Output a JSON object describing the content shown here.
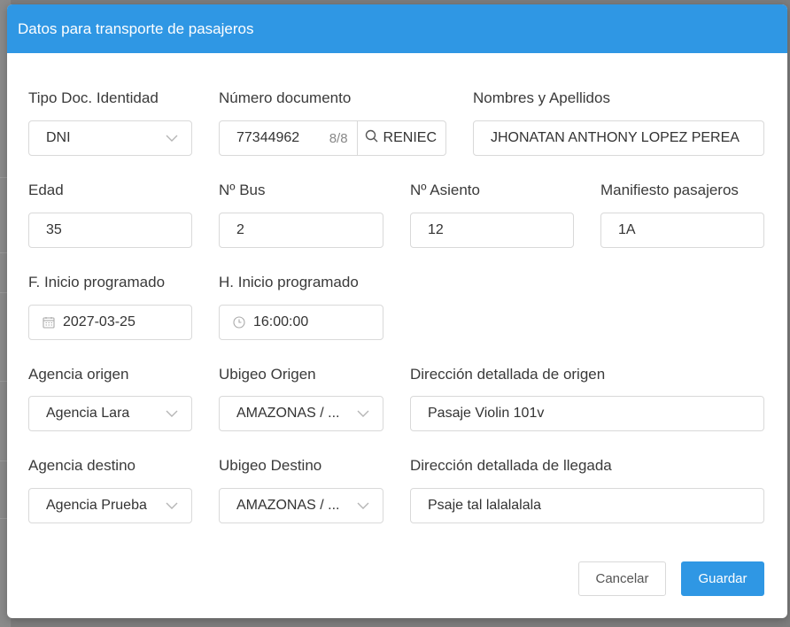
{
  "dialog": {
    "title": "Datos para transporte de pasajeros"
  },
  "fields": {
    "tipo_doc": {
      "label": "Tipo Doc. Identidad",
      "value": "DNI"
    },
    "numero_doc": {
      "label": "Número documento",
      "value": "77344962",
      "counter": "8/8",
      "lookup_label": "RENIEC"
    },
    "nombres": {
      "label": "Nombres y Apellidos",
      "value": "JHONATAN ANTHONY LOPEZ PEREA"
    },
    "edad": {
      "label": "Edad",
      "value": "35"
    },
    "bus": {
      "label": "Nº Bus",
      "value": "2"
    },
    "asiento": {
      "label": "Nº Asiento",
      "value": "12"
    },
    "manifiesto": {
      "label": "Manifiesto pasajeros",
      "value": "1A"
    },
    "fecha_inicio": {
      "label": "F. Inicio programado",
      "value": "2027-03-25"
    },
    "hora_inicio": {
      "label": "H. Inicio programado",
      "value": "16:00:00"
    },
    "agencia_origen": {
      "label": "Agencia origen",
      "value": "Agencia Lara"
    },
    "ubigeo_origen": {
      "label": "Ubigeo Origen",
      "value": "AMAZONAS / ..."
    },
    "direccion_origen": {
      "label": "Dirección detallada de origen",
      "value": "Pasaje Violin 101v"
    },
    "agencia_destino": {
      "label": "Agencia destino",
      "value": "Agencia Prueba"
    },
    "ubigeo_destino": {
      "label": "Ubigeo Destino",
      "value": "AMAZONAS / ..."
    },
    "direccion_llegada": {
      "label": "Dirección detallada de llegada",
      "value": "Psaje tal lalalalala"
    }
  },
  "actions": {
    "cancel_label": "Cancelar",
    "save_label": "Guardar"
  },
  "colors": {
    "accent": "#2f97e4",
    "border": "#d9d9d9",
    "overlay": "#7d7d7d"
  },
  "icons": {
    "select": "chevron-down-icon",
    "lookup": "search-icon",
    "date": "calendar-icon",
    "time": "clock-icon"
  }
}
